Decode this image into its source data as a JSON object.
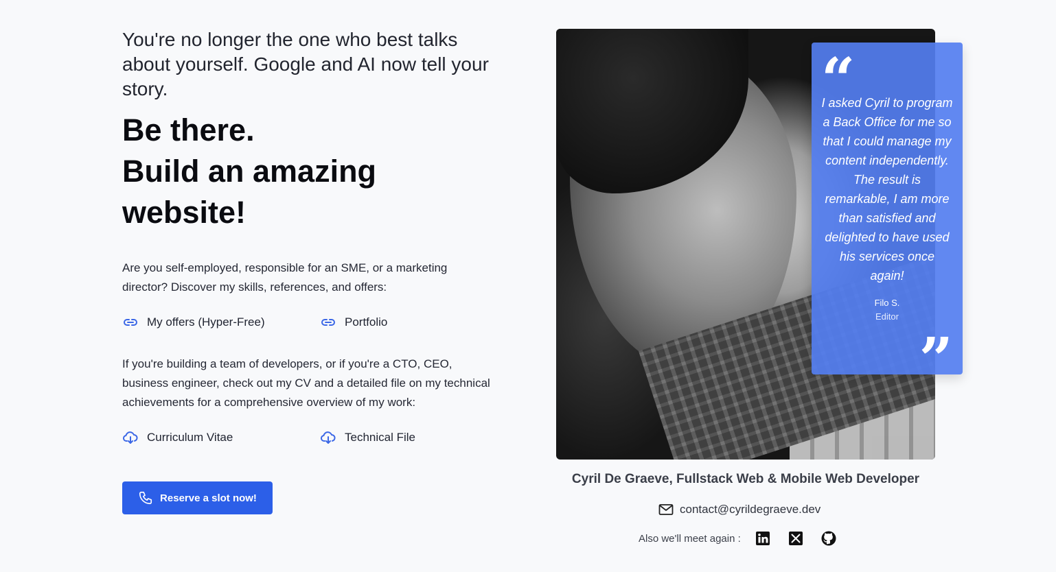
{
  "hero": {
    "intro": "You're no longer the one who best talks about yourself. Google and AI now tell your story.",
    "headline_line1": "Be there.",
    "headline_line2": "Build an amazing website!",
    "paragraph1": "Are you self-employed, responsible for an SME, or a marketing director? Discover my skills, references, and offers:",
    "links1": [
      {
        "label": "My offers (Hyper-Free)",
        "icon": "link-icon"
      },
      {
        "label": "Portfolio",
        "icon": "link-icon"
      }
    ],
    "paragraph2": "If you're building a team of developers, or if you're a CTO, CEO, business engineer, check out my CV and a detailed file on my technical achievements for a comprehensive overview of my work:",
    "links2": [
      {
        "label": "Curriculum Vitae",
        "icon": "cloud-download-icon"
      },
      {
        "label": "Technical File",
        "icon": "cloud-download-icon"
      }
    ],
    "cta_label": "Reserve a slot now!"
  },
  "testimonial": {
    "text": "I asked Cyril to program a Back Office for me so that I could manage my content independently. The result is remarkable, I am more than satisfied and delighted to have used his services once again!",
    "author": "Filo S.",
    "role": "Editor"
  },
  "profile": {
    "name_title": "Cyril De Graeve, Fullstack Web & Mobile Web Developer",
    "email": "contact@cyrildegraeve.dev",
    "social_label": "Also we'll meet again :",
    "social": [
      "linkedin-icon",
      "x-icon",
      "github-icon"
    ]
  },
  "colors": {
    "accent": "#2c5fe8",
    "quote_card": "#547ef0",
    "background": "#f8f9fb"
  }
}
